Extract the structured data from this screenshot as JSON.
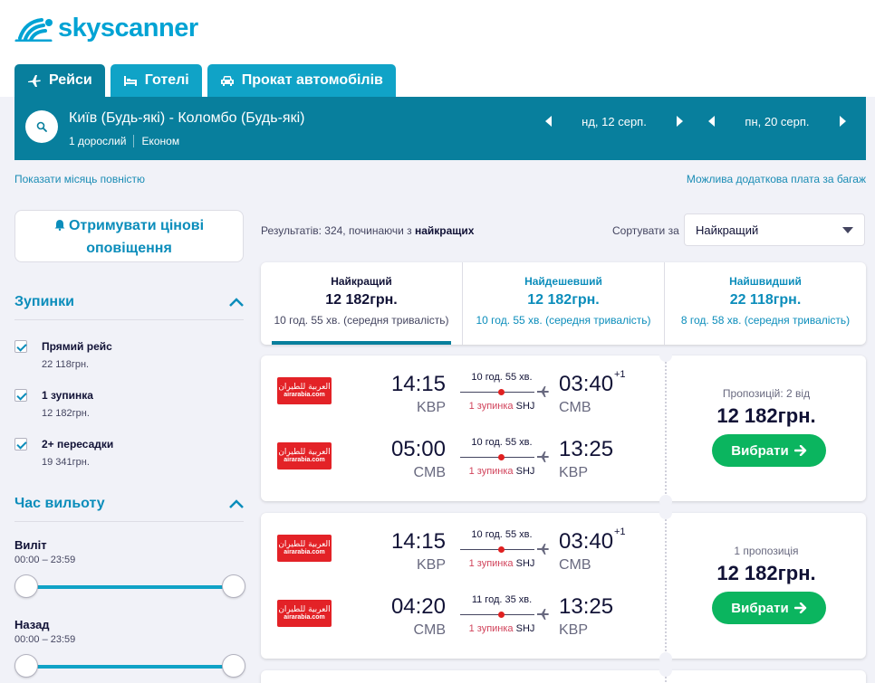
{
  "brand": {
    "name": "skyscanner",
    "color": "#00a3d4"
  },
  "tabs": [
    {
      "label": "Рейси",
      "icon": "plane-icon",
      "active": true
    },
    {
      "label": "Готелі",
      "icon": "bed-icon",
      "active": false
    },
    {
      "label": "Прокат автомобілів",
      "icon": "car-icon",
      "active": false
    }
  ],
  "search": {
    "route": "Київ (Будь-які) - Коломбо (Будь-які)",
    "passengers": "1 дорослий",
    "cabin": "Економ",
    "depart_date": "нд, 12 серп.",
    "return_date": "пн, 20 серп."
  },
  "links": {
    "full_month": "Показати місяць повністю",
    "baggage": "Можлива додаткова плата за багаж"
  },
  "sidebar": {
    "alert_line1": "Отримувати цінові",
    "alert_line2": "оповіщення",
    "stops_title": "Зупинки",
    "stops": [
      {
        "label": "Прямий рейс",
        "price": "22 118грн.",
        "checked": true
      },
      {
        "label": "1 зупинка",
        "price": "12 182грн.",
        "checked": true
      },
      {
        "label": "2+ пересадки",
        "price": "19 341грн.",
        "checked": true
      }
    ],
    "departure_title": "Час вильоту",
    "outbound_label": "Виліт",
    "outbound_range": "00:00 – 23:59",
    "return_label": "Назад",
    "return_range": "00:00 – 23:59"
  },
  "results": {
    "count_prefix": "Результатів: 324, починаючи з ",
    "count_bold": "найкращих",
    "sort_label": "Сортувати за",
    "sort_value": "Найкращий"
  },
  "sort_tabs": [
    {
      "title": "Найкращий",
      "price": "12 182грн.",
      "detail": "10 год. 55 хв. (середня тривалість)",
      "active": true
    },
    {
      "title": "Найдешевший",
      "price": "12 182грн.",
      "detail": "10 год. 55 хв. (середня тривалість)",
      "active": false
    },
    {
      "title": "Найшвидший",
      "price": "22 118грн.",
      "detail": "8 год. 58 хв. (середня тривалість)",
      "active": false
    }
  ],
  "airline": {
    "arabic": "العربية للطيران",
    "latin": "airarabia.com",
    "color": "#e32227"
  },
  "itineraries": [
    {
      "offers": "Пропозицій: 2 від",
      "price": "12 182грн.",
      "button": "Вибрати",
      "legs": [
        {
          "dep_time": "14:15",
          "dep_code": "KBP",
          "arr_time": "03:40",
          "arr_code": "CMB",
          "plus": "+1",
          "duration": "10 год. 55 хв.",
          "stops": "1 зупинка",
          "via": "SHJ"
        },
        {
          "dep_time": "05:00",
          "dep_code": "CMB",
          "arr_time": "13:25",
          "arr_code": "KBP",
          "plus": "",
          "duration": "10 год. 55 хв.",
          "stops": "1 зупинка",
          "via": "SHJ"
        }
      ]
    },
    {
      "offers": "1 пропозиція",
      "price": "12 182грн.",
      "button": "Вибрати",
      "legs": [
        {
          "dep_time": "14:15",
          "dep_code": "KBP",
          "arr_time": "03:40",
          "arr_code": "CMB",
          "plus": "+1",
          "duration": "10 год. 55 хв.",
          "stops": "1 зупинка",
          "via": "SHJ"
        },
        {
          "dep_time": "04:20",
          "dep_code": "CMB",
          "arr_time": "13:25",
          "arr_code": "KBP",
          "plus": "",
          "duration": "11 год. 35 хв.",
          "stops": "1 зупинка",
          "via": "SHJ"
        }
      ]
    }
  ]
}
